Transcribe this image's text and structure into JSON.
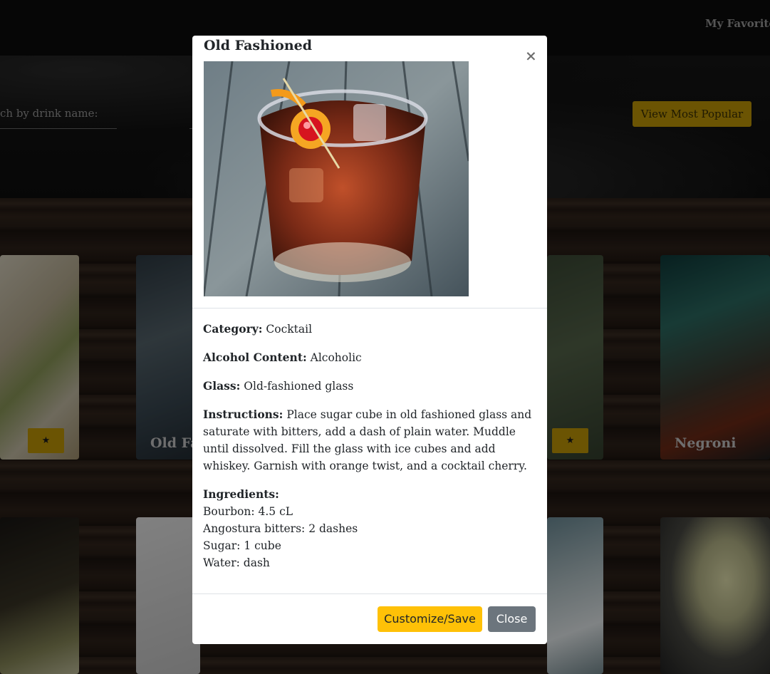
{
  "navbar": {
    "favorites_label": "My Favorite"
  },
  "hero": {
    "search_label": "ch by drink name:",
    "popular_button": "View Most Popular"
  },
  "background_cards": {
    "card2_name": "Old Fa",
    "card4_name": "Negroni",
    "star_icon": "★"
  },
  "modal": {
    "title": "Old Fashioned",
    "close_icon": "×",
    "details": {
      "category_label": "Category:",
      "category_value": "Cocktail",
      "alcohol_label": "Alcohol Content:",
      "alcohol_value": "Alcoholic",
      "glass_label": "Glass:",
      "glass_value": "Old-fashioned glass",
      "instructions_label": "Instructions:",
      "instructions_value": "Place sugar cube in old fashioned glass and saturate with bitters, add a dash of plain water. Muddle until dissolved. Fill the glass with ice cubes and add whiskey. Garnish with orange twist, and a cocktail cherry.",
      "ingredients_label": "Ingredients:",
      "ingredients": [
        "Bourbon: 4.5 cL",
        "Angostura bitters: 2 dashes",
        "Sugar: 1 cube",
        "Water: dash"
      ]
    },
    "footer": {
      "save_label": "Customize/Save",
      "close_label": "Close"
    }
  }
}
